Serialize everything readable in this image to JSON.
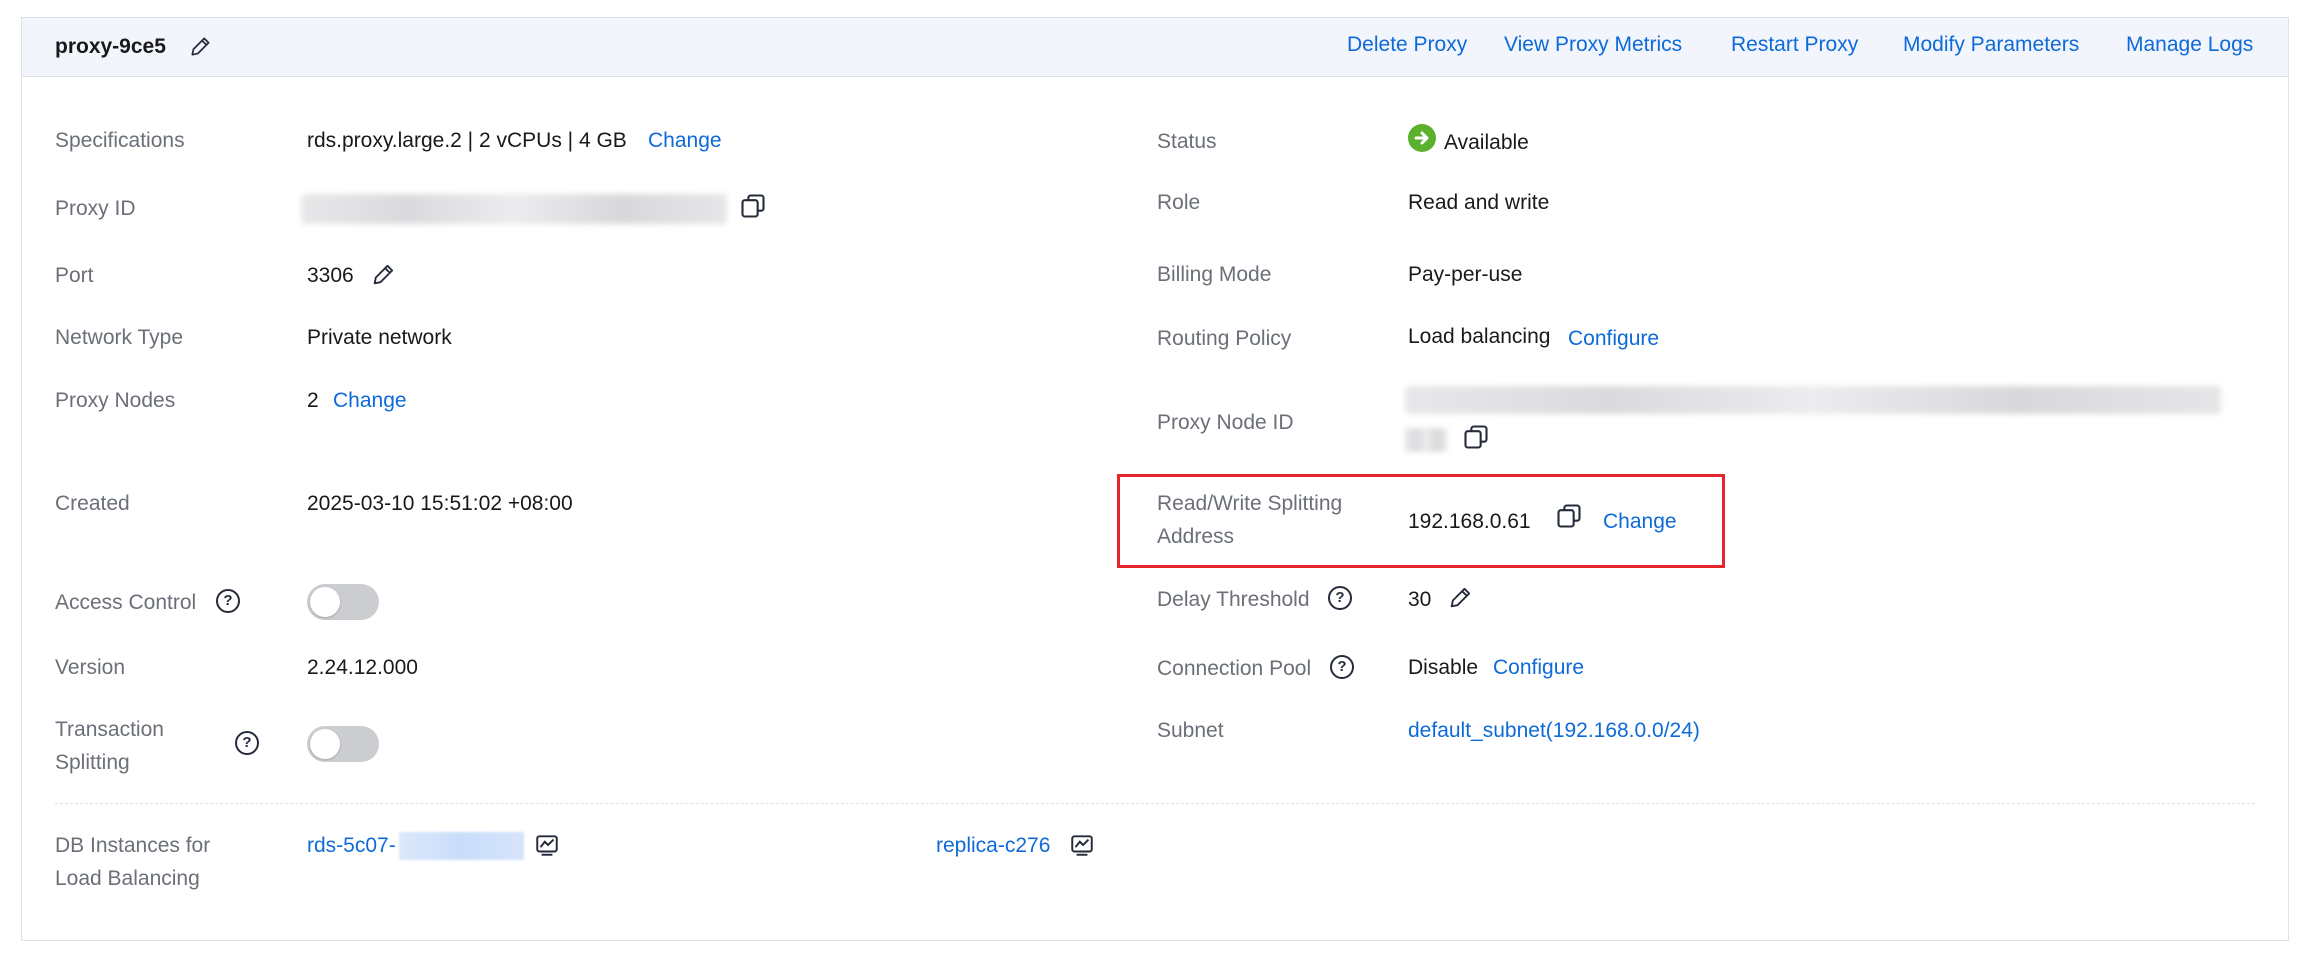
{
  "header": {
    "proxy_name": "proxy-9ce5",
    "actions": {
      "delete": "Delete Proxy",
      "metrics": "View Proxy Metrics",
      "restart": "Restart Proxy",
      "modify": "Modify Parameters",
      "logs": "Manage Logs"
    }
  },
  "left": {
    "specifications": {
      "label": "Specifications",
      "value": "rds.proxy.large.2 | 2 vCPUs | 4 GB",
      "action": "Change"
    },
    "proxy_id": {
      "label": "Proxy ID"
    },
    "port": {
      "label": "Port",
      "value": "3306"
    },
    "network_type": {
      "label": "Network Type",
      "value": "Private network"
    },
    "proxy_nodes": {
      "label": "Proxy Nodes",
      "value": "2",
      "action": "Change"
    },
    "created": {
      "label": "Created",
      "value": "2025-03-10 15:51:02 +08:00"
    },
    "access_control": {
      "label": "Access Control",
      "enabled": false
    },
    "version": {
      "label": "Version",
      "value": "2.24.12.000"
    },
    "transaction_splitting": {
      "label_line1": "Transaction",
      "label_line2": "Splitting",
      "enabled": false
    }
  },
  "right": {
    "status": {
      "label": "Status",
      "value": "Available",
      "color": "#5bb02e"
    },
    "role": {
      "label": "Role",
      "value": "Read and write"
    },
    "billing_mode": {
      "label": "Billing Mode",
      "value": "Pay-per-use"
    },
    "routing_policy": {
      "label": "Routing Policy",
      "value": "Load balancing",
      "action": "Configure"
    },
    "proxy_node_id": {
      "label": "Proxy Node ID"
    },
    "rw_address": {
      "label_line1": "Read/Write Splitting",
      "label_line2": "Address",
      "value": "192.168.0.61",
      "action": "Change"
    },
    "delay_threshold": {
      "label": "Delay Threshold",
      "value": "30"
    },
    "connection_pool": {
      "label": "Connection Pool",
      "value": "Disable",
      "action": "Configure"
    },
    "subnet": {
      "label": "Subnet",
      "value": "default_subnet(192.168.0.0/24)"
    }
  },
  "db_instances": {
    "label_line1": "DB Instances for",
    "label_line2": "Load Balancing",
    "primary": "rds-5c07-",
    "replica": "replica-c276"
  },
  "help_glyph": "?",
  "colors": {
    "link": "#0d6ad8",
    "highlight": "#e3262c",
    "header_bg": "#f2f5fc"
  }
}
